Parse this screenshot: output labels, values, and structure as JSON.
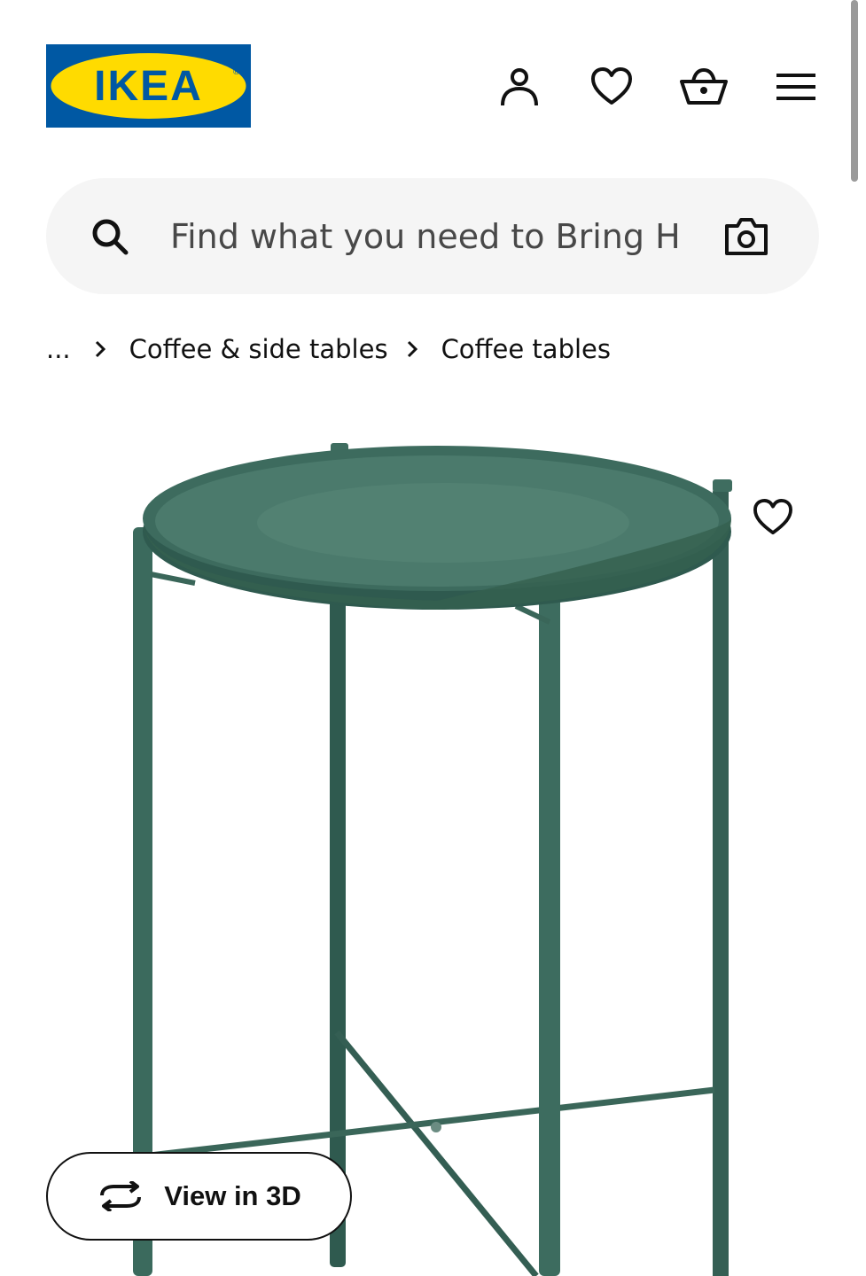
{
  "header": {
    "logo_text": "IKEA",
    "brand_colors": {
      "blue": "#0058a3",
      "yellow": "#ffdb00"
    },
    "icons": [
      "person-icon",
      "heart-icon",
      "basket-icon",
      "menu-icon"
    ]
  },
  "search": {
    "placeholder": "Find what you need to Bring H",
    "icon": "search-icon",
    "camera_icon": "camera-icon"
  },
  "breadcrumb": {
    "overflow": "...",
    "items": [
      "Coffee & side tables",
      "Coffee tables"
    ]
  },
  "product": {
    "image_alt": "green round tray table",
    "table_color": "#3d6b5e",
    "favorite_icon": "heart-icon"
  },
  "view_3d": {
    "label": "View in 3D",
    "icon": "rotate-icon"
  }
}
